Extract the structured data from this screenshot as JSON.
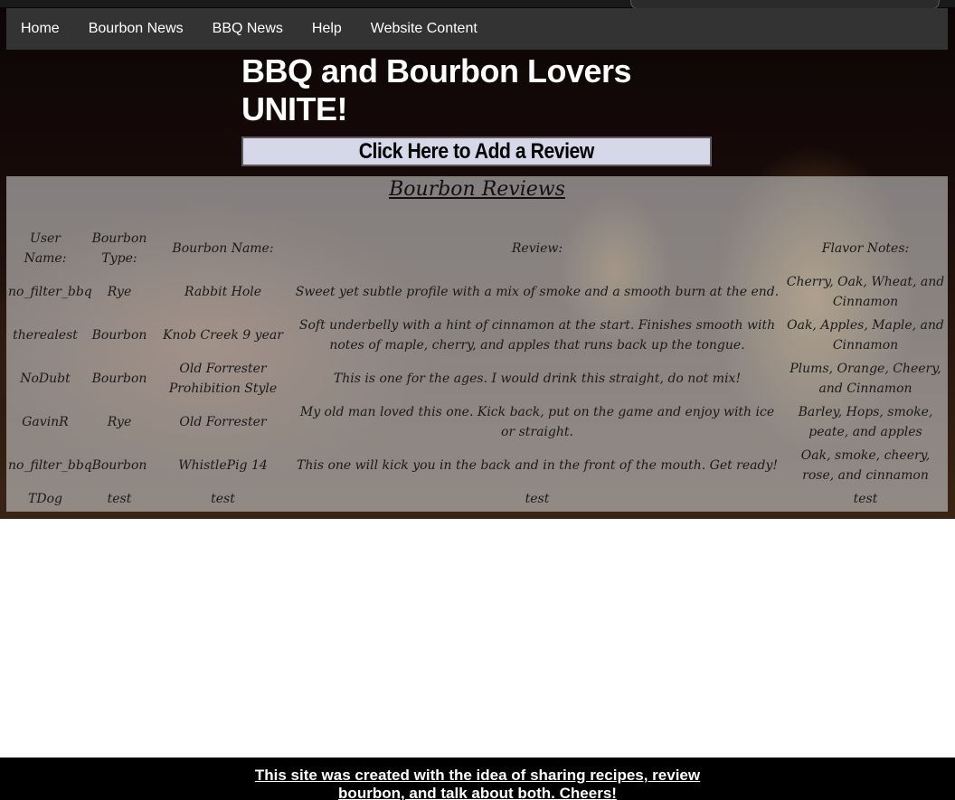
{
  "nav": {
    "items": [
      {
        "label": "Home"
      },
      {
        "label": "Bourbon News"
      },
      {
        "label": "BBQ News"
      },
      {
        "label": "Help"
      },
      {
        "label": "Website Content"
      }
    ]
  },
  "header": {
    "title": "BBQ and Bourbon Lovers UNITE!"
  },
  "add_review_button": {
    "label": "Click Here to Add a Review"
  },
  "reviews": {
    "title": "Bourbon Reviews",
    "columns": [
      "User Name:",
      "Bourbon Type:",
      "Bourbon Name:",
      "Review:",
      "Flavor Notes:"
    ],
    "rows": [
      [
        "no_filter_bbq",
        "Rye",
        "Rabbit Hole",
        "Sweet yet subtle profile with a mix of smoke and a smooth burn at the end.",
        "Cherry, Oak, Wheat, and Cinnamon"
      ],
      [
        "therealest",
        "Bourbon",
        "Knob Creek 9 year",
        "Soft underbelly with a hint of cinnamon at the start. Finishes smooth with notes of maple, cherry, and apples that runs back up the tongue.",
        "Oak, Apples, Maple, and Cinnamon"
      ],
      [
        "NoDubt",
        "Bourbon",
        "Old Forrester Prohibition Style",
        "This is one for the ages. I would drink this straight, do not mix!",
        "Plums, Orange, Cheery, and Cinnamon"
      ],
      [
        "GavinR",
        "Rye",
        "Old Forrester",
        "My old man loved this one. Kick back, put on the game and enjoy with ice or straight.",
        "Barley, Hops, smoke, peate, and apples"
      ],
      [
        "no_filter_bbq",
        "Bourbon",
        "WhistlePig 14",
        "This one will kick you in the back and in the front of the mouth. Get ready!",
        "Oak, smoke, cheery, rose, and cinnamon"
      ],
      [
        "TDog",
        "test",
        "test",
        "test",
        "test"
      ]
    ]
  },
  "footer": {
    "text": "This site was created with the idea of sharing recipes, review bourbon, and talk about both. Cheers!"
  }
}
